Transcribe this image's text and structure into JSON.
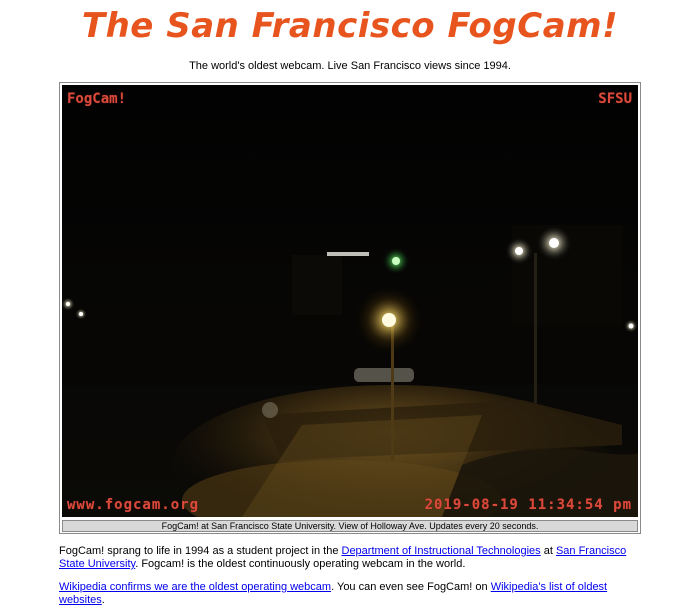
{
  "page": {
    "title": "The San Francisco FogCam!",
    "tagline": "The world's oldest webcam. Live San Francisco views since 1994."
  },
  "webcam": {
    "overlay_top_left": "FogCam!",
    "overlay_top_right": "SFSU",
    "overlay_bottom_left": "www.fogcam.org",
    "overlay_bottom_right": "2019-08-19 11:34:54 pm",
    "caption": "FogCam! at San Francisco State University. View of Holloway Ave. Updates every 20 seconds."
  },
  "paragraph1": {
    "text_a": "FogCam! sprang to life in 1994 as a student project in the ",
    "link_a": "Department of Instructional Technologies",
    "text_b": " at ",
    "link_b": "San Francisco State University",
    "text_c": ". Fogcam! is the oldest continuously operating webcam in the world."
  },
  "paragraph2": {
    "link_a": "Wikipedia confirms we are the oldest operating webcam",
    "text_a": ". You can even see FogCam! on ",
    "link_b": "Wikipedia's list of oldest websites",
    "text_b": "."
  },
  "colors": {
    "title": "#e8541e",
    "overlay_text": "#d94a3c",
    "link": "#0000ee"
  }
}
